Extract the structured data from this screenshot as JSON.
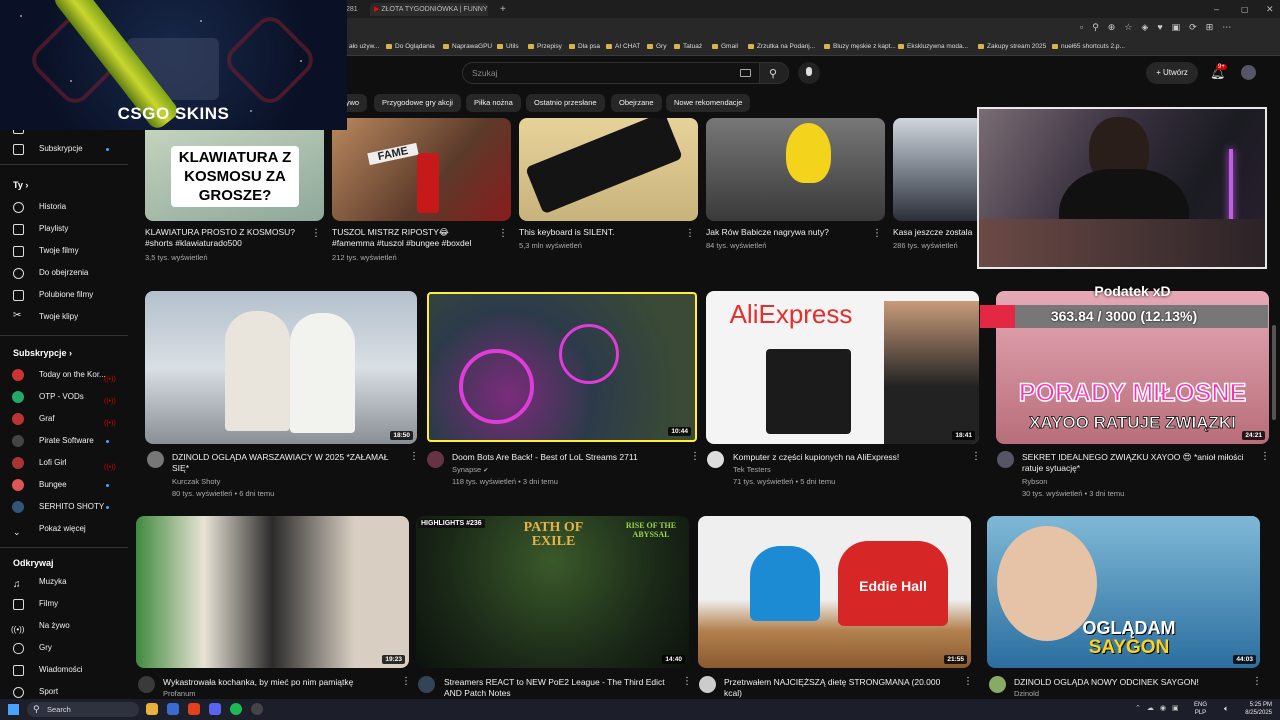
{
  "browser": {
    "tabs": [
      "281",
      "ZŁOTA TYGODNIÓWKA | FUNNY"
    ],
    "bookmarks": [
      "ało używ...",
      "Do Oglądania",
      "NaprawaGPU",
      "Utils",
      "Przepisy",
      "Dla psa",
      "AI CHAT",
      "Gry",
      "Tatuaż",
      "Gmail",
      "Zrzutka na Podanj...",
      "Bluzy męskie z kapt...",
      "Ekskluzywna moda...",
      "Zakupy stream 2025",
      "nuel65 shortcuts 2.p..."
    ]
  },
  "overlay": {
    "logo": "CSGO SKINS"
  },
  "youtube": {
    "search_placeholder": "Szukaj",
    "create_label": "Utwórz",
    "notif_count": "9+",
    "chips": [
      "żywo",
      "Przygodowe gry akcji",
      "Piłka nożna",
      "Ostatnio przesłane",
      "Obejrzane",
      "Nowe rekomendacje"
    ]
  },
  "sidebar": {
    "top": [
      {
        "label": "Shorts"
      },
      {
        "label": "Subskrypcje"
      }
    ],
    "you_header": "Ty",
    "you": [
      {
        "label": "Historia"
      },
      {
        "label": "Playlisty"
      },
      {
        "label": "Twoje filmy"
      },
      {
        "label": "Do obejrzenia"
      },
      {
        "label": "Polubione filmy"
      },
      {
        "label": "Twoje klipy"
      }
    ],
    "subs_header": "Subskrypcje",
    "subs": [
      {
        "label": "Today on the Kor...",
        "color": "#c33",
        "status": "live"
      },
      {
        "label": "OTP - VODs",
        "color": "#2a6",
        "status": "live"
      },
      {
        "label": "Graf",
        "color": "#b33",
        "status": "live"
      },
      {
        "label": "Pirate Software",
        "color": "#444",
        "status": "dot"
      },
      {
        "label": "Lofi Girl",
        "color": "#a33",
        "status": "live"
      },
      {
        "label": "Bungee",
        "color": "#d55",
        "status": "dot"
      },
      {
        "label": "SERHITO SHOTY",
        "color": "#357",
        "status": "dot"
      }
    ],
    "show_more": "Pokaż więcej",
    "explore_header": "Odkrywaj",
    "explore": [
      {
        "label": "Muzyka"
      },
      {
        "label": "Filmy"
      },
      {
        "label": "Na żywo"
      },
      {
        "label": "Gry"
      },
      {
        "label": "Wiadomości"
      },
      {
        "label": "Sport"
      }
    ]
  },
  "shorts": [
    {
      "title": "KLAWIATURA PROSTO Z KOSMOSU? #shorts #klawiaturado500",
      "views": "3,5 tys. wyświetleń",
      "thumb_text": "KLAWIATURA Z KOSMOSU ZA GROSZE?"
    },
    {
      "title": "TUSZOL MISTRZ RIPOSTY😂 #famemma #tuszol #bungee #boxdel",
      "views": "212 tys. wyświetleń",
      "thumb_text": "FAME"
    },
    {
      "title": "This keyboard is SILENT.",
      "views": "5,3 mln wyświetleń",
      "thumb_text": ""
    },
    {
      "title": "Jak Rów Babicze nagrywa nuty?",
      "views": "84 tys. wyświetleń",
      "thumb_text": ""
    },
    {
      "title": "Kasa jeszcze zostala",
      "views": "286 tys. wyświetleń",
      "thumb_text": ""
    }
  ],
  "row2": [
    {
      "title": "DZINOLD OGLĄDA WARSZAWIACY W 2025 *ZAŁAMAŁ SIĘ*",
      "channel": "Kurczak Shoty",
      "stats": "80 tys. wyświetleń • 6 dni temu",
      "duration": "18:50",
      "thumb_text": ""
    },
    {
      "title": "Doom Bots Are Back! - Best of LoL Streams 2711",
      "channel": "Synapse",
      "stats": "118 tys. wyświetleń • 3 dni temu",
      "duration": "10:44",
      "thumb_text": ""
    },
    {
      "title": "Komputer z części kupionych na AliExpress!",
      "channel": "Tek Testers",
      "stats": "71 tys. wyświetleń • 5 dni temu",
      "duration": "18:41",
      "thumb_text": "AliExpress"
    },
    {
      "title": "SEKRET IDEALNEGO ZWIĄZKU XAYOO 😍 *anioł miłości ratuje sytuację*",
      "channel": "Rybson",
      "stats": "30 tys. wyświetleń • 3 dni temu",
      "duration": "24:21",
      "thumb_text": "PORADY MIŁOSNE",
      "thumb_text2": "XAYOO RATUJE ZWIĄZKI"
    }
  ],
  "row3": [
    {
      "title": "Wykastrowała kochanka, by mieć po nim pamiątkę",
      "channel": "Profanum",
      "duration": "19:23"
    },
    {
      "title": "Streamers REACT to NEW PoE2 League - The Third Edict AND Patch Notes",
      "channel": "",
      "duration": "14:40",
      "thumb_text": "HIGHLIGHTS #236",
      "thumb_text2": "PATH OF EXILE",
      "thumb_text3": "RISE OF THE ABYSSAL"
    },
    {
      "title": "Przetrwałem NAJCIĘŻSZĄ dietę STRONGMANA (20.000 kcal)",
      "channel": "",
      "duration": "21:55",
      "thumb_text": "Eddie Hall"
    },
    {
      "title": "DZINOLD OGLĄDA NOWY ODCINEK SAYGON!",
      "channel": "Dzinold",
      "duration": "44:03",
      "thumb_text": "OGLĄDAM",
      "thumb_text2": "SAYGON"
    }
  ],
  "goal_overlay": {
    "title": "Podatek xD",
    "progress_text": "363.84 / 3000 (12.13%)",
    "progress": 0.1213
  },
  "taskbar": {
    "search": "Search",
    "lang": "ENG",
    "layout": "PLP",
    "time": "5:25 PM",
    "date": "8/25/2025"
  }
}
